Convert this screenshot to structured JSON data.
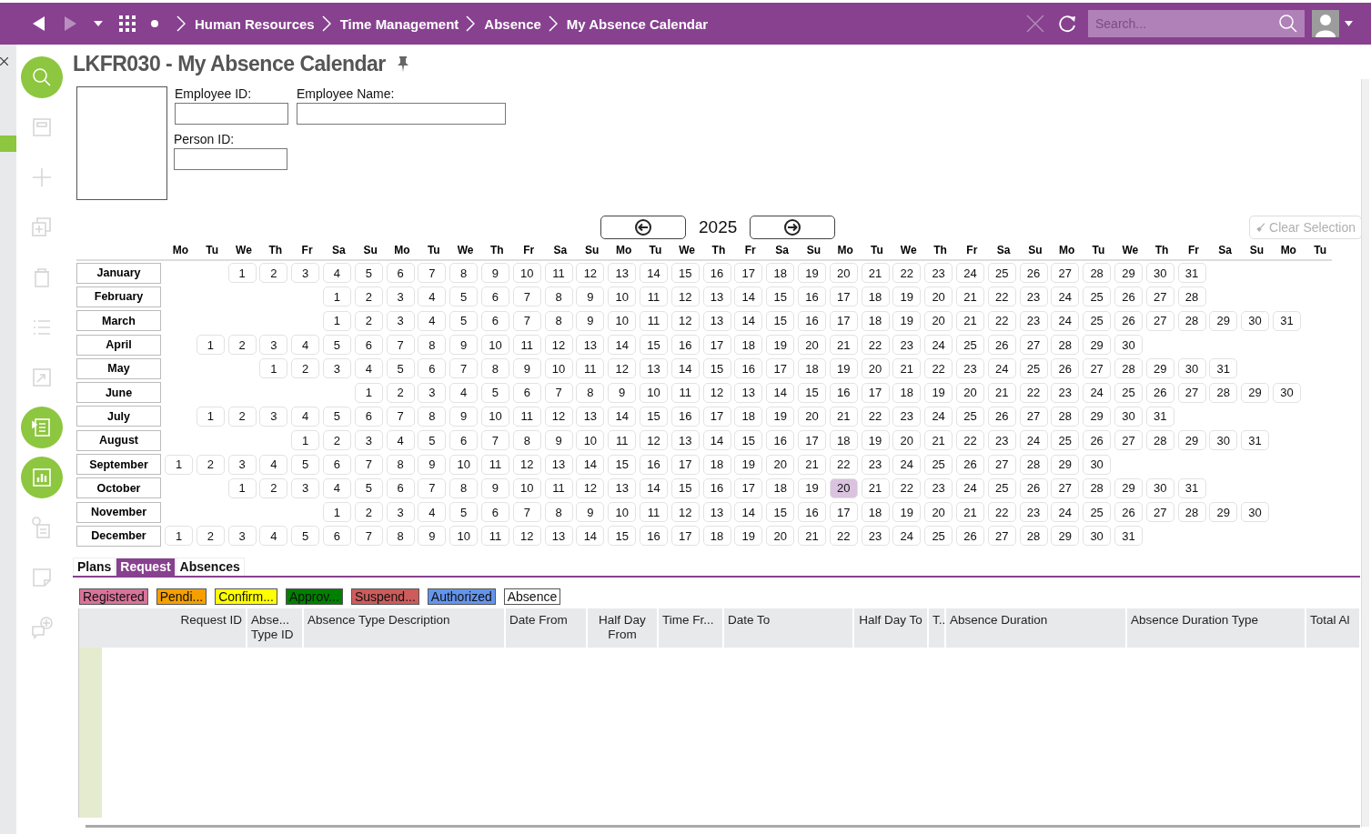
{
  "topbar": {
    "breadcrumbs": [
      "Human Resources",
      "Time Management",
      "Absence",
      "My Absence Calendar"
    ],
    "search": {
      "placeholder": "Search..."
    }
  },
  "sidebar": {
    "tools": [
      {
        "kind": "search",
        "active": true
      },
      {
        "kind": "save",
        "active": false
      },
      {
        "kind": "add",
        "active": false
      },
      {
        "kind": "duplicate",
        "active": false
      },
      {
        "kind": "delete",
        "active": false
      },
      {
        "kind": "list",
        "active": false
      },
      {
        "kind": "export",
        "active": false
      },
      {
        "kind": "report",
        "active": true
      },
      {
        "kind": "chart",
        "active": true
      },
      {
        "kind": "info",
        "active": false
      },
      {
        "kind": "note",
        "active": false
      },
      {
        "kind": "comment",
        "active": false
      }
    ]
  },
  "page": {
    "title": "LKFR030 - My Absence Calendar"
  },
  "form": {
    "fields": [
      {
        "label": "Employee ID:"
      },
      {
        "label": "Employee Name:"
      },
      {
        "label": "Person ID:"
      }
    ]
  },
  "calendar": {
    "year": "2025",
    "clear_button": {
      "label": "Clear Selection",
      "disabled": true
    },
    "weekdays": [
      "Mo",
      "Tu",
      "We",
      "Th",
      "Fr",
      "Sa",
      "Su",
      "Mo",
      "Tu",
      "We",
      "Th",
      "Fr",
      "Sa",
      "Su",
      "Mo",
      "Tu",
      "We",
      "Th",
      "Fr",
      "Sa",
      "Su",
      "Mo",
      "Tu",
      "We",
      "Th",
      "Fr",
      "Sa",
      "Su",
      "Mo",
      "Tu",
      "We",
      "Th",
      "Fr",
      "Sa",
      "Su",
      "Mo",
      "Tu"
    ],
    "months": [
      {
        "name": "January",
        "days": [
          {
            "day": "1",
            "selected": false
          },
          {
            "day": "2",
            "selected": false
          },
          {
            "day": "3",
            "selected": false
          },
          {
            "day": "4",
            "selected": false
          },
          {
            "day": "5",
            "selected": false
          },
          {
            "day": "6",
            "selected": false
          },
          {
            "day": "7",
            "selected": false
          },
          {
            "day": "8",
            "selected": false
          },
          {
            "day": "9",
            "selected": false
          },
          {
            "day": "10",
            "selected": false
          },
          {
            "day": "11",
            "selected": false
          },
          {
            "day": "12",
            "selected": false
          },
          {
            "day": "13",
            "selected": false
          },
          {
            "day": "14",
            "selected": false
          },
          {
            "day": "15",
            "selected": false
          },
          {
            "day": "16",
            "selected": false
          },
          {
            "day": "17",
            "selected": false
          },
          {
            "day": "18",
            "selected": false
          },
          {
            "day": "19",
            "selected": false
          },
          {
            "day": "20",
            "selected": false
          },
          {
            "day": "21",
            "selected": false
          },
          {
            "day": "22",
            "selected": false
          },
          {
            "day": "23",
            "selected": false
          },
          {
            "day": "24",
            "selected": false
          },
          {
            "day": "25",
            "selected": false
          },
          {
            "day": "26",
            "selected": false
          },
          {
            "day": "27",
            "selected": false
          },
          {
            "day": "28",
            "selected": false
          },
          {
            "day": "29",
            "selected": false
          },
          {
            "day": "30",
            "selected": false
          },
          {
            "day": "31",
            "selected": false
          }
        ]
      },
      {
        "name": "February",
        "days": [
          {
            "day": "1",
            "selected": false
          },
          {
            "day": "2",
            "selected": false
          },
          {
            "day": "3",
            "selected": false
          },
          {
            "day": "4",
            "selected": false
          },
          {
            "day": "5",
            "selected": false
          },
          {
            "day": "6",
            "selected": false
          },
          {
            "day": "7",
            "selected": false
          },
          {
            "day": "8",
            "selected": false
          },
          {
            "day": "9",
            "selected": false
          },
          {
            "day": "10",
            "selected": false
          },
          {
            "day": "11",
            "selected": false
          },
          {
            "day": "12",
            "selected": false
          },
          {
            "day": "13",
            "selected": false
          },
          {
            "day": "14",
            "selected": false
          },
          {
            "day": "15",
            "selected": false
          },
          {
            "day": "16",
            "selected": false
          },
          {
            "day": "17",
            "selected": false
          },
          {
            "day": "18",
            "selected": false
          },
          {
            "day": "19",
            "selected": false
          },
          {
            "day": "20",
            "selected": false
          },
          {
            "day": "21",
            "selected": false
          },
          {
            "day": "22",
            "selected": false
          },
          {
            "day": "23",
            "selected": false
          },
          {
            "day": "24",
            "selected": false
          },
          {
            "day": "25",
            "selected": false
          },
          {
            "day": "26",
            "selected": false
          },
          {
            "day": "27",
            "selected": false
          },
          {
            "day": "28",
            "selected": false
          }
        ]
      },
      {
        "name": "March",
        "days": [
          {
            "day": "1",
            "selected": false
          },
          {
            "day": "2",
            "selected": false
          },
          {
            "day": "3",
            "selected": false
          },
          {
            "day": "4",
            "selected": false
          },
          {
            "day": "5",
            "selected": false
          },
          {
            "day": "6",
            "selected": false
          },
          {
            "day": "7",
            "selected": false
          },
          {
            "day": "8",
            "selected": false
          },
          {
            "day": "9",
            "selected": false
          },
          {
            "day": "10",
            "selected": false
          },
          {
            "day": "11",
            "selected": false
          },
          {
            "day": "12",
            "selected": false
          },
          {
            "day": "13",
            "selected": false
          },
          {
            "day": "14",
            "selected": false
          },
          {
            "day": "15",
            "selected": false
          },
          {
            "day": "16",
            "selected": false
          },
          {
            "day": "17",
            "selected": false
          },
          {
            "day": "18",
            "selected": false
          },
          {
            "day": "19",
            "selected": false
          },
          {
            "day": "20",
            "selected": false
          },
          {
            "day": "21",
            "selected": false
          },
          {
            "day": "22",
            "selected": false
          },
          {
            "day": "23",
            "selected": false
          },
          {
            "day": "24",
            "selected": false
          },
          {
            "day": "25",
            "selected": false
          },
          {
            "day": "26",
            "selected": false
          },
          {
            "day": "27",
            "selected": false
          },
          {
            "day": "28",
            "selected": false
          },
          {
            "day": "29",
            "selected": false
          },
          {
            "day": "30",
            "selected": false
          },
          {
            "day": "31",
            "selected": false
          }
        ]
      },
      {
        "name": "April",
        "days": [
          {
            "day": "1",
            "selected": false
          },
          {
            "day": "2",
            "selected": false
          },
          {
            "day": "3",
            "selected": false
          },
          {
            "day": "4",
            "selected": false
          },
          {
            "day": "5",
            "selected": false
          },
          {
            "day": "6",
            "selected": false
          },
          {
            "day": "7",
            "selected": false
          },
          {
            "day": "8",
            "selected": false
          },
          {
            "day": "9",
            "selected": false
          },
          {
            "day": "10",
            "selected": false
          },
          {
            "day": "11",
            "selected": false
          },
          {
            "day": "12",
            "selected": false
          },
          {
            "day": "13",
            "selected": false
          },
          {
            "day": "14",
            "selected": false
          },
          {
            "day": "15",
            "selected": false
          },
          {
            "day": "16",
            "selected": false
          },
          {
            "day": "17",
            "selected": false
          },
          {
            "day": "18",
            "selected": false
          },
          {
            "day": "19",
            "selected": false
          },
          {
            "day": "20",
            "selected": false
          },
          {
            "day": "21",
            "selected": false
          },
          {
            "day": "22",
            "selected": false
          },
          {
            "day": "23",
            "selected": false
          },
          {
            "day": "24",
            "selected": false
          },
          {
            "day": "25",
            "selected": false
          },
          {
            "day": "26",
            "selected": false
          },
          {
            "day": "27",
            "selected": false
          },
          {
            "day": "28",
            "selected": false
          },
          {
            "day": "29",
            "selected": false
          },
          {
            "day": "30",
            "selected": false
          }
        ]
      },
      {
        "name": "May",
        "days": [
          {
            "day": "1",
            "selected": false
          },
          {
            "day": "2",
            "selected": false
          },
          {
            "day": "3",
            "selected": false
          },
          {
            "day": "4",
            "selected": false
          },
          {
            "day": "5",
            "selected": false
          },
          {
            "day": "6",
            "selected": false
          },
          {
            "day": "7",
            "selected": false
          },
          {
            "day": "8",
            "selected": false
          },
          {
            "day": "9",
            "selected": false
          },
          {
            "day": "10",
            "selected": false
          },
          {
            "day": "11",
            "selected": false
          },
          {
            "day": "12",
            "selected": false
          },
          {
            "day": "13",
            "selected": false
          },
          {
            "day": "14",
            "selected": false
          },
          {
            "day": "15",
            "selected": false
          },
          {
            "day": "16",
            "selected": false
          },
          {
            "day": "17",
            "selected": false
          },
          {
            "day": "18",
            "selected": false
          },
          {
            "day": "19",
            "selected": false
          },
          {
            "day": "20",
            "selected": false
          },
          {
            "day": "21",
            "selected": false
          },
          {
            "day": "22",
            "selected": false
          },
          {
            "day": "23",
            "selected": false
          },
          {
            "day": "24",
            "selected": false
          },
          {
            "day": "25",
            "selected": false
          },
          {
            "day": "26",
            "selected": false
          },
          {
            "day": "27",
            "selected": false
          },
          {
            "day": "28",
            "selected": false
          },
          {
            "day": "29",
            "selected": false
          },
          {
            "day": "30",
            "selected": false
          },
          {
            "day": "31",
            "selected": false
          }
        ]
      },
      {
        "name": "June",
        "days": [
          {
            "day": "1",
            "selected": false
          },
          {
            "day": "2",
            "selected": false
          },
          {
            "day": "3",
            "selected": false
          },
          {
            "day": "4",
            "selected": false
          },
          {
            "day": "5",
            "selected": false
          },
          {
            "day": "6",
            "selected": false
          },
          {
            "day": "7",
            "selected": false
          },
          {
            "day": "8",
            "selected": false
          },
          {
            "day": "9",
            "selected": false
          },
          {
            "day": "10",
            "selected": false
          },
          {
            "day": "11",
            "selected": false
          },
          {
            "day": "12",
            "selected": false
          },
          {
            "day": "13",
            "selected": false
          },
          {
            "day": "14",
            "selected": false
          },
          {
            "day": "15",
            "selected": false
          },
          {
            "day": "16",
            "selected": false
          },
          {
            "day": "17",
            "selected": false
          },
          {
            "day": "18",
            "selected": false
          },
          {
            "day": "19",
            "selected": false
          },
          {
            "day": "20",
            "selected": false
          },
          {
            "day": "21",
            "selected": false
          },
          {
            "day": "22",
            "selected": false
          },
          {
            "day": "23",
            "selected": false
          },
          {
            "day": "24",
            "selected": false
          },
          {
            "day": "25",
            "selected": false
          },
          {
            "day": "26",
            "selected": false
          },
          {
            "day": "27",
            "selected": false
          },
          {
            "day": "28",
            "selected": false
          },
          {
            "day": "29",
            "selected": false
          },
          {
            "day": "30",
            "selected": false
          }
        ]
      },
      {
        "name": "July",
        "days": [
          {
            "day": "1",
            "selected": false
          },
          {
            "day": "2",
            "selected": false
          },
          {
            "day": "3",
            "selected": false
          },
          {
            "day": "4",
            "selected": false
          },
          {
            "day": "5",
            "selected": false
          },
          {
            "day": "6",
            "selected": false
          },
          {
            "day": "7",
            "selected": false
          },
          {
            "day": "8",
            "selected": false
          },
          {
            "day": "9",
            "selected": false
          },
          {
            "day": "10",
            "selected": false
          },
          {
            "day": "11",
            "selected": false
          },
          {
            "day": "12",
            "selected": false
          },
          {
            "day": "13",
            "selected": false
          },
          {
            "day": "14",
            "selected": false
          },
          {
            "day": "15",
            "selected": false
          },
          {
            "day": "16",
            "selected": false
          },
          {
            "day": "17",
            "selected": false
          },
          {
            "day": "18",
            "selected": false
          },
          {
            "day": "19",
            "selected": false
          },
          {
            "day": "20",
            "selected": false
          },
          {
            "day": "21",
            "selected": false
          },
          {
            "day": "22",
            "selected": false
          },
          {
            "day": "23",
            "selected": false
          },
          {
            "day": "24",
            "selected": false
          },
          {
            "day": "25",
            "selected": false
          },
          {
            "day": "26",
            "selected": false
          },
          {
            "day": "27",
            "selected": false
          },
          {
            "day": "28",
            "selected": false
          },
          {
            "day": "29",
            "selected": false
          },
          {
            "day": "30",
            "selected": false
          },
          {
            "day": "31",
            "selected": false
          }
        ]
      },
      {
        "name": "August",
        "days": [
          {
            "day": "1",
            "selected": false
          },
          {
            "day": "2",
            "selected": false
          },
          {
            "day": "3",
            "selected": false
          },
          {
            "day": "4",
            "selected": false
          },
          {
            "day": "5",
            "selected": false
          },
          {
            "day": "6",
            "selected": false
          },
          {
            "day": "7",
            "selected": false
          },
          {
            "day": "8",
            "selected": false
          },
          {
            "day": "9",
            "selected": false
          },
          {
            "day": "10",
            "selected": false
          },
          {
            "day": "11",
            "selected": false
          },
          {
            "day": "12",
            "selected": false
          },
          {
            "day": "13",
            "selected": false
          },
          {
            "day": "14",
            "selected": false
          },
          {
            "day": "15",
            "selected": false
          },
          {
            "day": "16",
            "selected": false
          },
          {
            "day": "17",
            "selected": false
          },
          {
            "day": "18",
            "selected": false
          },
          {
            "day": "19",
            "selected": false
          },
          {
            "day": "20",
            "selected": false
          },
          {
            "day": "21",
            "selected": false
          },
          {
            "day": "22",
            "selected": false
          },
          {
            "day": "23",
            "selected": false
          },
          {
            "day": "24",
            "selected": false
          },
          {
            "day": "25",
            "selected": false
          },
          {
            "day": "26",
            "selected": false
          },
          {
            "day": "27",
            "selected": false
          },
          {
            "day": "28",
            "selected": false
          },
          {
            "day": "29",
            "selected": false
          },
          {
            "day": "30",
            "selected": false
          },
          {
            "day": "31",
            "selected": false
          }
        ]
      },
      {
        "name": "September",
        "days": [
          {
            "day": "1",
            "selected": false
          },
          {
            "day": "2",
            "selected": false
          },
          {
            "day": "3",
            "selected": false
          },
          {
            "day": "4",
            "selected": false
          },
          {
            "day": "5",
            "selected": false
          },
          {
            "day": "6",
            "selected": false
          },
          {
            "day": "7",
            "selected": false
          },
          {
            "day": "8",
            "selected": false
          },
          {
            "day": "9",
            "selected": false
          },
          {
            "day": "10",
            "selected": false
          },
          {
            "day": "11",
            "selected": false
          },
          {
            "day": "12",
            "selected": false
          },
          {
            "day": "13",
            "selected": false
          },
          {
            "day": "14",
            "selected": false
          },
          {
            "day": "15",
            "selected": false
          },
          {
            "day": "16",
            "selected": false
          },
          {
            "day": "17",
            "selected": false
          },
          {
            "day": "18",
            "selected": false
          },
          {
            "day": "19",
            "selected": false
          },
          {
            "day": "20",
            "selected": false
          },
          {
            "day": "21",
            "selected": false
          },
          {
            "day": "22",
            "selected": false
          },
          {
            "day": "23",
            "selected": false
          },
          {
            "day": "24",
            "selected": false
          },
          {
            "day": "25",
            "selected": false
          },
          {
            "day": "26",
            "selected": false
          },
          {
            "day": "27",
            "selected": false
          },
          {
            "day": "28",
            "selected": false
          },
          {
            "day": "29",
            "selected": false
          },
          {
            "day": "30",
            "selected": false
          }
        ]
      },
      {
        "name": "October",
        "days": [
          {
            "day": "1",
            "selected": false
          },
          {
            "day": "2",
            "selected": false
          },
          {
            "day": "3",
            "selected": false
          },
          {
            "day": "4",
            "selected": false
          },
          {
            "day": "5",
            "selected": false
          },
          {
            "day": "6",
            "selected": false
          },
          {
            "day": "7",
            "selected": false
          },
          {
            "day": "8",
            "selected": false
          },
          {
            "day": "9",
            "selected": false
          },
          {
            "day": "10",
            "selected": false
          },
          {
            "day": "11",
            "selected": false
          },
          {
            "day": "12",
            "selected": false
          },
          {
            "day": "13",
            "selected": false
          },
          {
            "day": "14",
            "selected": false
          },
          {
            "day": "15",
            "selected": false
          },
          {
            "day": "16",
            "selected": false
          },
          {
            "day": "17",
            "selected": false
          },
          {
            "day": "18",
            "selected": false
          },
          {
            "day": "19",
            "selected": false
          },
          {
            "day": "20",
            "selected": true
          },
          {
            "day": "21",
            "selected": false
          },
          {
            "day": "22",
            "selected": false
          },
          {
            "day": "23",
            "selected": false
          },
          {
            "day": "24",
            "selected": false
          },
          {
            "day": "25",
            "selected": false
          },
          {
            "day": "26",
            "selected": false
          },
          {
            "day": "27",
            "selected": false
          },
          {
            "day": "28",
            "selected": false
          },
          {
            "day": "29",
            "selected": false
          },
          {
            "day": "30",
            "selected": false
          },
          {
            "day": "31",
            "selected": false
          }
        ]
      },
      {
        "name": "November",
        "days": [
          {
            "day": "1",
            "selected": false
          },
          {
            "day": "2",
            "selected": false
          },
          {
            "day": "3",
            "selected": false
          },
          {
            "day": "4",
            "selected": false
          },
          {
            "day": "5",
            "selected": false
          },
          {
            "day": "6",
            "selected": false
          },
          {
            "day": "7",
            "selected": false
          },
          {
            "day": "8",
            "selected": false
          },
          {
            "day": "9",
            "selected": false
          },
          {
            "day": "10",
            "selected": false
          },
          {
            "day": "11",
            "selected": false
          },
          {
            "day": "12",
            "selected": false
          },
          {
            "day": "13",
            "selected": false
          },
          {
            "day": "14",
            "selected": false
          },
          {
            "day": "15",
            "selected": false
          },
          {
            "day": "16",
            "selected": false
          },
          {
            "day": "17",
            "selected": false
          },
          {
            "day": "18",
            "selected": false
          },
          {
            "day": "19",
            "selected": false
          },
          {
            "day": "20",
            "selected": false
          },
          {
            "day": "21",
            "selected": false
          },
          {
            "day": "22",
            "selected": false
          },
          {
            "day": "23",
            "selected": false
          },
          {
            "day": "24",
            "selected": false
          },
          {
            "day": "25",
            "selected": false
          },
          {
            "day": "26",
            "selected": false
          },
          {
            "day": "27",
            "selected": false
          },
          {
            "day": "28",
            "selected": false
          },
          {
            "day": "29",
            "selected": false
          },
          {
            "day": "30",
            "selected": false
          }
        ]
      },
      {
        "name": "December",
        "days": [
          {
            "day": "1",
            "selected": false
          },
          {
            "day": "2",
            "selected": false
          },
          {
            "day": "3",
            "selected": false
          },
          {
            "day": "4",
            "selected": false
          },
          {
            "day": "5",
            "selected": false
          },
          {
            "day": "6",
            "selected": false
          },
          {
            "day": "7",
            "selected": false
          },
          {
            "day": "8",
            "selected": false
          },
          {
            "day": "9",
            "selected": false
          },
          {
            "day": "10",
            "selected": false
          },
          {
            "day": "11",
            "selected": false
          },
          {
            "day": "12",
            "selected": false
          },
          {
            "day": "13",
            "selected": false
          },
          {
            "day": "14",
            "selected": false
          },
          {
            "day": "15",
            "selected": false
          },
          {
            "day": "16",
            "selected": false
          },
          {
            "day": "17",
            "selected": false
          },
          {
            "day": "18",
            "selected": false
          },
          {
            "day": "19",
            "selected": false
          },
          {
            "day": "20",
            "selected": false
          },
          {
            "day": "21",
            "selected": false
          },
          {
            "day": "22",
            "selected": false
          },
          {
            "day": "23",
            "selected": false
          },
          {
            "day": "24",
            "selected": false
          },
          {
            "day": "25",
            "selected": false
          },
          {
            "day": "26",
            "selected": false
          },
          {
            "day": "27",
            "selected": false
          },
          {
            "day": "28",
            "selected": false
          },
          {
            "day": "29",
            "selected": false
          },
          {
            "day": "30",
            "selected": false
          },
          {
            "day": "31",
            "selected": false
          }
        ]
      }
    ]
  },
  "tabs": [
    {
      "label": "Plans",
      "selected": false
    },
    {
      "label": "Request",
      "selected": true
    },
    {
      "label": "Absences",
      "selected": false
    }
  ],
  "legend": [
    {
      "label": "Registered",
      "color": "#d9739a"
    },
    {
      "label": "Pendi...",
      "color": "#f5a000"
    },
    {
      "label": "Confirm...",
      "color": "#ffff00"
    },
    {
      "label": "Approv...",
      "color": "#008000"
    },
    {
      "label": "Suspend...",
      "color": "#cd5c5c"
    },
    {
      "label": "Authorized",
      "color": "#6495ed"
    },
    {
      "label": "Absence",
      "color": "#ffffff"
    }
  ],
  "table": {
    "columns": [
      {
        "label": "Request ID"
      },
      {
        "label": "Abse... Type ID"
      },
      {
        "label": "Absence Type Description"
      },
      {
        "label": "Date From"
      },
      {
        "label": "Half Day From"
      },
      {
        "label": "Time Fr..."
      },
      {
        "label": "Date To"
      },
      {
        "label": "Half Day To"
      },
      {
        "label": "T.."
      },
      {
        "label": "Absence Duration"
      },
      {
        "label": "Absence Duration Type"
      },
      {
        "label": "Total Al"
      }
    ]
  }
}
